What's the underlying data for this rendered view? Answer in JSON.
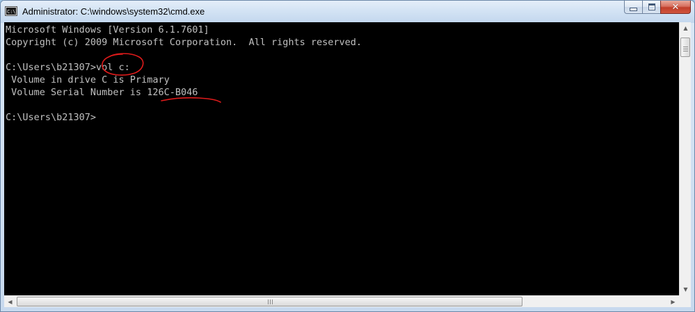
{
  "window": {
    "title": "Administrator: C:\\windows\\system32\\cmd.exe",
    "app_icon_text": "C:\\",
    "close_glyph": "✕"
  },
  "console": {
    "lines": [
      "Microsoft Windows [Version 6.1.7601]",
      "Copyright (c) 2009 Microsoft Corporation.  All rights reserved.",
      "",
      "C:\\Users\\b21307>vol c:",
      " Volume in drive C is Primary",
      " Volume Serial Number is 126C-B046",
      "",
      "C:\\Users\\b21307>"
    ],
    "text_color": "#c0c0c0",
    "background_color": "#000000",
    "annotation_color": "#e01b1b"
  },
  "scrollbars": {
    "up_arrow": "▲",
    "down_arrow": "▼",
    "left_arrow": "◀",
    "right_arrow": "▶"
  }
}
